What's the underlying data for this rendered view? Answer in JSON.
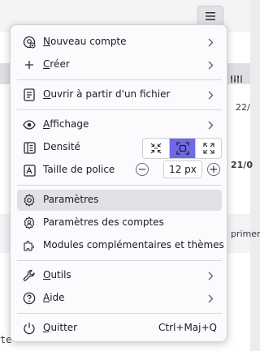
{
  "background": {
    "hamburger_icon": "hamburger-icon",
    "date_fragment_1": "22/",
    "date_fragment_2": "21/0",
    "toolbar_fragment": "primer",
    "bottom_fragment": "te",
    "columns_icon": "columns-icon"
  },
  "menu": {
    "items": [
      {
        "label": "Nouveau compte",
        "mnemonic": "N",
        "rest": "ouveau compte",
        "icon": "add-account-icon",
        "submenu": true
      },
      {
        "label": "Créer",
        "mnemonic": "C",
        "rest": "réer",
        "icon": "plus-icon",
        "submenu": true
      },
      {
        "label": "Ouvrir à partir d'un fichier",
        "mnemonic": "O",
        "rest": "uvrir à partir d'un fichier",
        "icon": "open-file-icon",
        "submenu": true
      },
      {
        "label": "Affichage",
        "mnemonic": "A",
        "rest": "ffichage",
        "icon": "eye-icon",
        "submenu": true
      },
      {
        "label": "Densité",
        "icon": "density-icon"
      },
      {
        "label": "Taille de police",
        "icon": "font-size-icon"
      },
      {
        "label": "Paramètres",
        "icon": "gear-icon",
        "highlighted": true
      },
      {
        "label": "Paramètres des comptes",
        "icon": "account-settings-icon"
      },
      {
        "label": "Modules complémentaires et thèmes",
        "icon": "addons-icon"
      },
      {
        "label": "Outils",
        "mnemonic": "O",
        "rest": "utils",
        "icon": "wrench-icon",
        "submenu": true
      },
      {
        "label": "Aide",
        "mnemonic": "A",
        "rest": "ide",
        "icon": "help-icon",
        "submenu": true
      },
      {
        "label": "Quitter",
        "mnemonic": "Q",
        "rest": "uitter",
        "icon": "power-icon",
        "shortcut": "Ctrl+Maj+Q"
      }
    ],
    "density": {
      "options": [
        "compact-density-icon",
        "normal-density-icon",
        "relaxed-density-icon"
      ],
      "selected": 1,
      "accent": "#6e6ae6"
    },
    "font_size": {
      "value": "12 px",
      "decrease": "−",
      "increase": "+"
    }
  }
}
